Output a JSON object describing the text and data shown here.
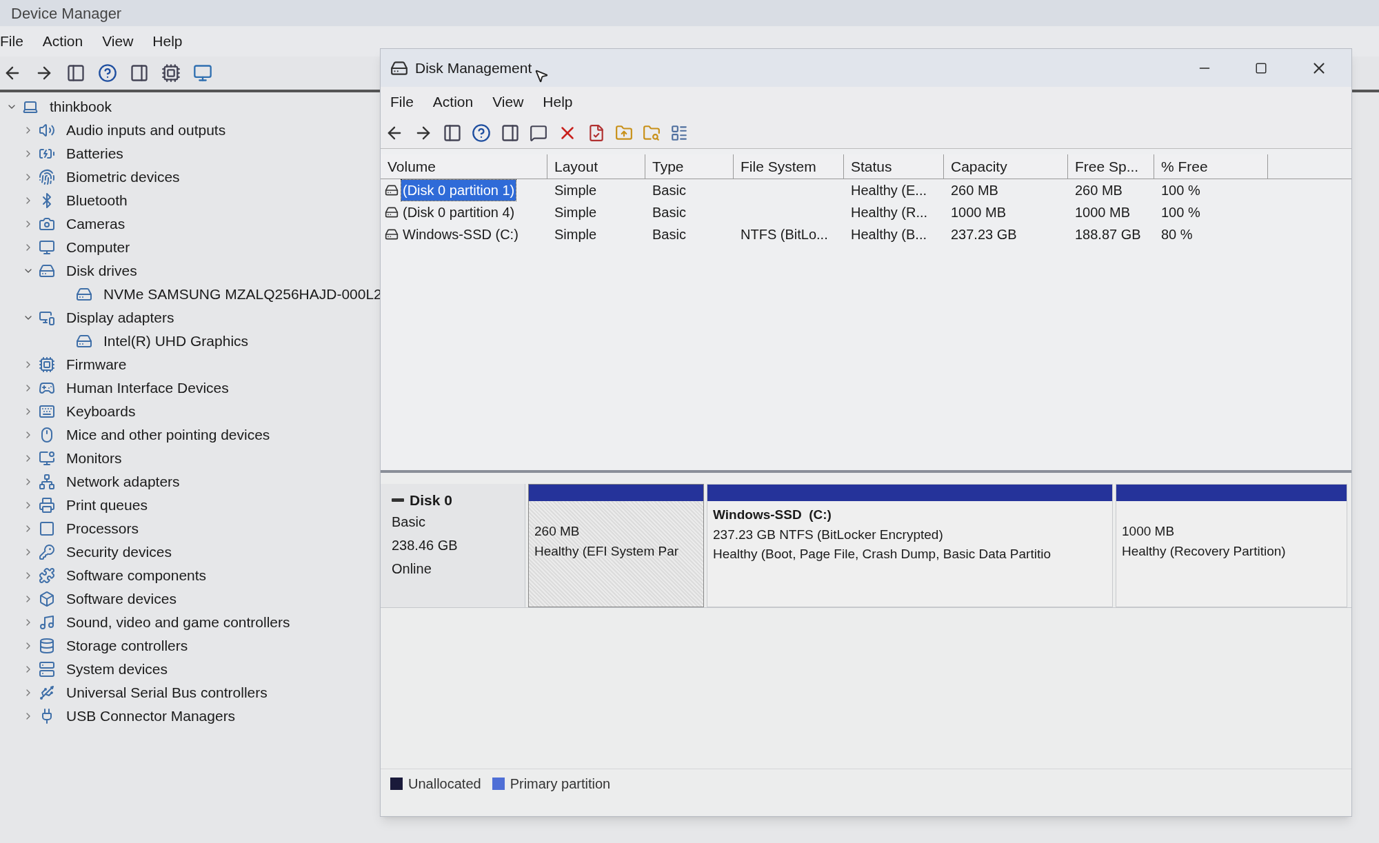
{
  "device_manager": {
    "title": "Device Manager",
    "menu": [
      "File",
      "Action",
      "View",
      "Help"
    ],
    "tree": {
      "label": "thinkbook",
      "expanded": true,
      "children": [
        {
          "label": "Audio inputs and outputs",
          "expanded": false
        },
        {
          "label": "Batteries",
          "expanded": false
        },
        {
          "label": "Biometric devices",
          "expanded": false
        },
        {
          "label": "Bluetooth",
          "expanded": false
        },
        {
          "label": "Cameras",
          "expanded": false
        },
        {
          "label": "Computer",
          "expanded": false
        },
        {
          "label": "Disk drives",
          "expanded": true,
          "children": [
            {
              "label": "NVMe SAMSUNG MZALQ256HAJD-000L2"
            }
          ]
        },
        {
          "label": "Display adapters",
          "expanded": true,
          "children": [
            {
              "label": "Intel(R) UHD Graphics"
            }
          ]
        },
        {
          "label": "Firmware",
          "expanded": false
        },
        {
          "label": "Human Interface Devices",
          "expanded": false
        },
        {
          "label": "Keyboards",
          "expanded": false
        },
        {
          "label": "Mice and other pointing devices",
          "expanded": false
        },
        {
          "label": "Monitors",
          "expanded": false
        },
        {
          "label": "Network adapters",
          "expanded": false
        },
        {
          "label": "Print queues",
          "expanded": false
        },
        {
          "label": "Processors",
          "expanded": false
        },
        {
          "label": "Security devices",
          "expanded": false
        },
        {
          "label": "Software components",
          "expanded": false
        },
        {
          "label": "Software devices",
          "expanded": false
        },
        {
          "label": "Sound, video and game controllers",
          "expanded": false
        },
        {
          "label": "Storage controllers",
          "expanded": false
        },
        {
          "label": "System devices",
          "expanded": false
        },
        {
          "label": "Universal Serial Bus controllers",
          "expanded": false
        },
        {
          "label": "USB Connector Managers",
          "expanded": false
        }
      ]
    }
  },
  "disk_management": {
    "title": "Disk Management",
    "menu": [
      "File",
      "Action",
      "View",
      "Help"
    ],
    "table": {
      "columns": [
        "Volume",
        "Layout",
        "Type",
        "File System",
        "Status",
        "Capacity",
        "Free Sp...",
        "% Free"
      ],
      "rows": [
        {
          "selected": true,
          "cells": [
            "(Disk 0 partition 1)",
            "Simple",
            "Basic",
            "",
            "Healthy (E...",
            "260 MB",
            "260 MB",
            "100 %"
          ]
        },
        {
          "selected": false,
          "cells": [
            "(Disk 0 partition 4)",
            "Simple",
            "Basic",
            "",
            "Healthy (R...",
            "1000 MB",
            "1000 MB",
            "100 %"
          ]
        },
        {
          "selected": false,
          "cells": [
            "Windows-SSD (C:)",
            "Simple",
            "Basic",
            "NTFS (BitLo...",
            "Healthy (B...",
            "237.23 GB",
            "188.87 GB",
            "80 %"
          ]
        }
      ]
    },
    "disk": {
      "name": "Disk 0",
      "type": "Basic",
      "size": "238.46 GB",
      "status": "Online"
    },
    "partitions": [
      {
        "selected": true,
        "lines": [
          "260 MB",
          "Healthy (EFI System Par"
        ]
      },
      {
        "selected": false,
        "title": "Windows-SSD  (C:)",
        "lines": [
          "237.23 GB NTFS (BitLocker Encrypted)",
          "Healthy (Boot, Page File, Crash Dump, Basic Data Partitio"
        ]
      },
      {
        "selected": false,
        "lines": [
          "1000 MB",
          "Healthy (Recovery Partition)"
        ]
      }
    ],
    "legend": [
      {
        "label": "Unallocated",
        "color": "#1a1a3a"
      },
      {
        "label": "Primary partition",
        "color": "#4f6fd6"
      }
    ]
  }
}
